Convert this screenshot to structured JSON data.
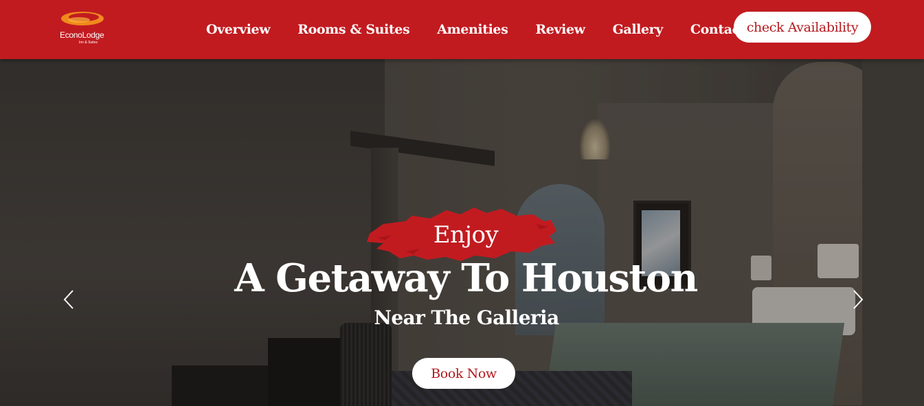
{
  "brand": {
    "name": "EconoLodge",
    "tagline": "Inn & Suites",
    "logo_icon": "econolodge-swoosh-logo"
  },
  "nav": {
    "items": [
      {
        "label": "Overview"
      },
      {
        "label": "Rooms & Suites"
      },
      {
        "label": "Amenities"
      },
      {
        "label": "Review"
      },
      {
        "label": "Gallery"
      },
      {
        "label": "Contact Us"
      }
    ],
    "cta_label": "check Availability"
  },
  "hero": {
    "kicker": "Enjoy",
    "title": "A Getaway To Houston",
    "subtitle": "Near The Galleria",
    "button_label": "Book Now",
    "prev_icon": "chevron-left-icon",
    "next_icon": "chevron-right-icon"
  },
  "colors": {
    "brand_red": "#c11b20",
    "button_text_red": "#b3191e",
    "white": "#ffffff"
  }
}
